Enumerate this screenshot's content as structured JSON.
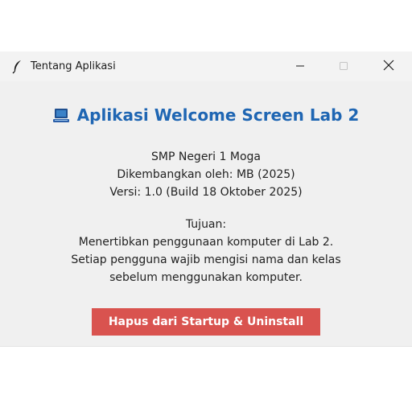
{
  "window": {
    "title": "Tentang Aplikasi",
    "icons": {
      "app": "feather-icon",
      "minimize": "minimize-icon",
      "maximize": "maximize-icon",
      "close": "close-icon"
    }
  },
  "content": {
    "heading": "Aplikasi Welcome Screen Lab 2",
    "heading_icon": "computer-icon",
    "heading_color": "#1f66b3",
    "school": "SMP Negeri 1 Moga",
    "developer": "Dikembangkan oleh: MB (2025)",
    "version": "Versi: 1.0 (Build 18 Oktober 2025)",
    "purpose_title": "Tujuan:",
    "purpose_lines": [
      "Menertibkan penggunaan komputer di Lab 2.",
      "Setiap pengguna wajib mengisi nama dan kelas",
      "sebelum menggunakan komputer."
    ]
  },
  "actions": {
    "uninstall_label": "Hapus dari Startup & Uninstall",
    "uninstall_color": "#d9534f"
  }
}
